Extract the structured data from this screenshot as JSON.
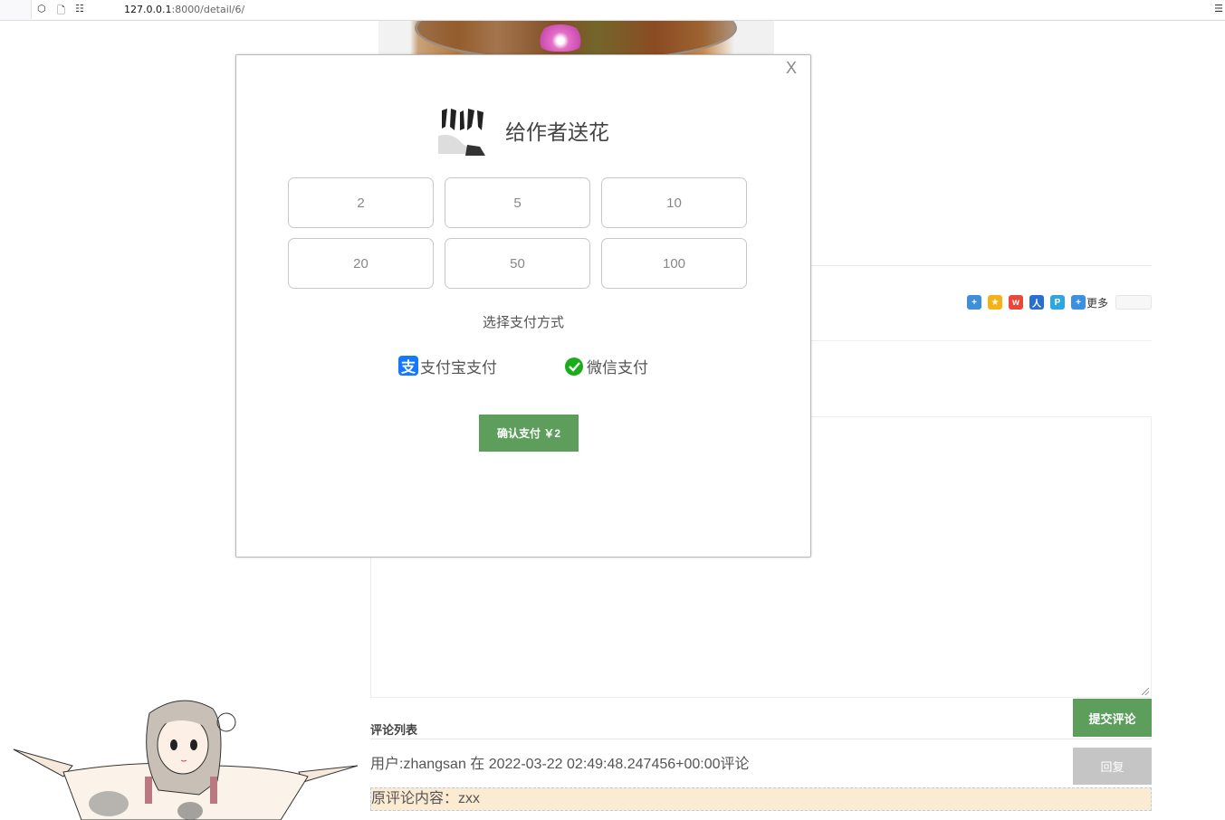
{
  "browser": {
    "url_host": "127.0.0.1",
    "url_path": ":8000/detail/6/"
  },
  "share": {
    "more_label": "更多"
  },
  "comments": {
    "submit_label": "提交评论",
    "list_title": "评论列表",
    "items": [
      {
        "meta": "用户:zhangsan 在 2022-03-22 02:49:48.247456+00:00评论",
        "reply_label": "回复",
        "original": "原评论内容：zxx"
      }
    ]
  },
  "modal": {
    "close": "X",
    "title": "给作者送花",
    "amounts": [
      "2",
      "5",
      "10",
      "20",
      "50",
      "100"
    ],
    "pay_method_label": "选择支付方式",
    "alipay_label": "支付宝支付",
    "wechat_label": "微信支付",
    "confirm_label": "确认支付 ￥2"
  },
  "colors": {
    "primary_green": "#5d9e5d",
    "reply_gray": "#c5c5c5",
    "alipay_blue": "#1678ff",
    "wechat_green": "#1aad19"
  }
}
